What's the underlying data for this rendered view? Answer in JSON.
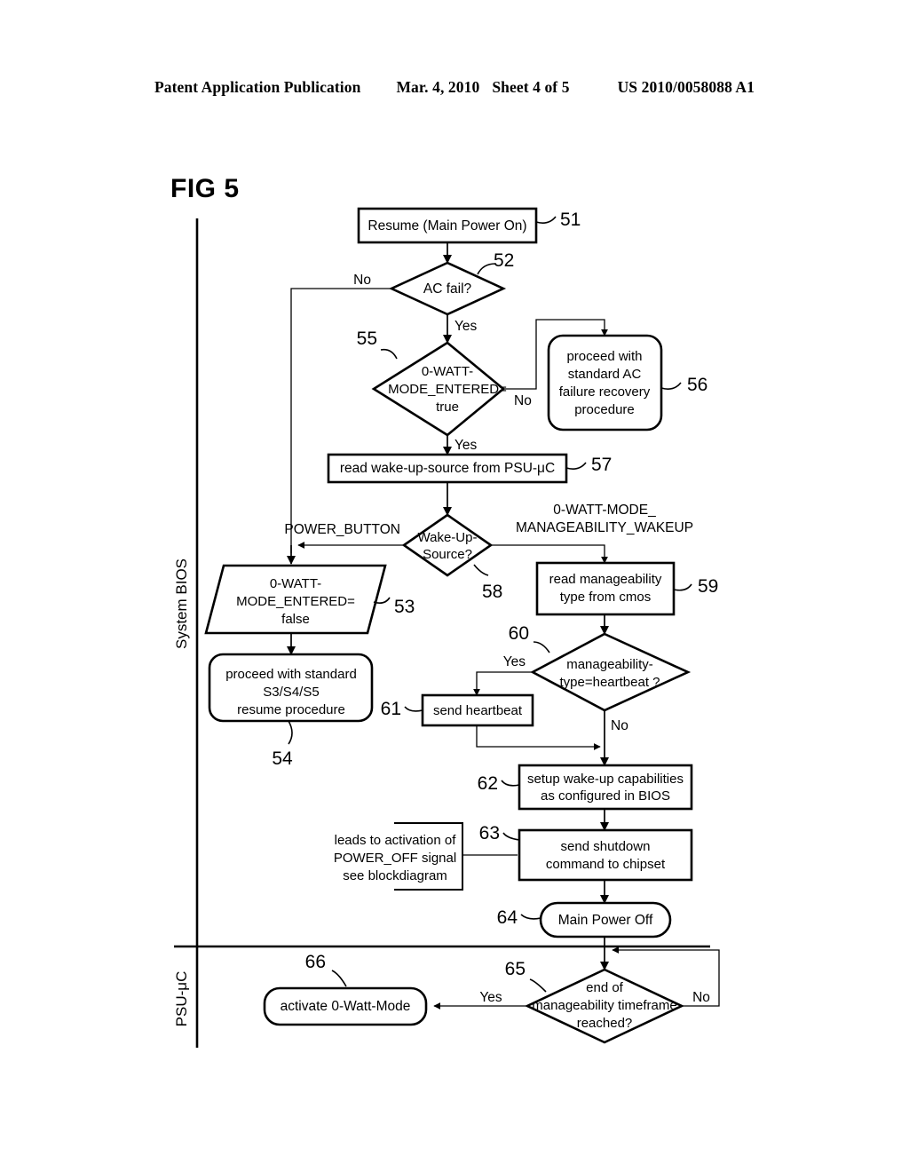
{
  "header": {
    "publication": "Patent Application Publication",
    "date": "Mar. 4, 2010",
    "sheet": "Sheet 4 of 5",
    "number": "US 2010/0058088 A1"
  },
  "figure": {
    "label": "FIG 5"
  },
  "lanes": [
    {
      "id": "system-bios",
      "label": "System BIOS"
    },
    {
      "id": "psu-uc",
      "label": "PSU-μC"
    }
  ],
  "nodes": {
    "n51": {
      "ref": "51",
      "text": "Resume (Main Power On)",
      "shape": "process"
    },
    "n52": {
      "ref": "52",
      "text": "AC fail?",
      "shape": "decision"
    },
    "n55": {
      "ref": "55",
      "line1": "0-WATT-",
      "line2": "MODE_ENTERED=",
      "line3": "true",
      "shape": "decision"
    },
    "n56": {
      "ref": "56",
      "line1": "proceed with",
      "line2": "standard AC",
      "line3": "failure recovery",
      "line4": "procedure",
      "shape": "rounded"
    },
    "n57": {
      "ref": "57",
      "text": "read wake-up-source from PSU-μC",
      "shape": "process"
    },
    "n58": {
      "ref": "58",
      "line1": "Wake-Up-",
      "line2": "Source?",
      "shape": "decision"
    },
    "n53": {
      "ref": "53",
      "line1": "0-WATT-",
      "line2": "MODE_ENTERED=",
      "line3": "false",
      "shape": "parallelogram"
    },
    "n54": {
      "ref": "54",
      "line1": "proceed with standard",
      "line2": "S3/S4/S5",
      "line3": "resume procedure",
      "shape": "rounded"
    },
    "n59": {
      "ref": "59",
      "line1": "read manageability",
      "line2": "type from cmos",
      "shape": "process"
    },
    "n60": {
      "ref": "60",
      "line1": "manageability-",
      "line2": "type=heartbeat ?",
      "shape": "decision"
    },
    "n61": {
      "ref": "61",
      "text": "send heartbeat",
      "shape": "process"
    },
    "n62": {
      "ref": "62",
      "line1": "setup wake-up capabilities",
      "line2": "as configured in BIOS",
      "shape": "process"
    },
    "n63": {
      "ref": "63",
      "line1": "send shutdown",
      "line2": "command to chipset",
      "shape": "process"
    },
    "n64": {
      "ref": "64",
      "text": "Main Power Off",
      "shape": "stadium"
    },
    "n65": {
      "ref": "65",
      "line1": "end of",
      "line2": "manageability timeframe",
      "line3": "reached?",
      "shape": "decision"
    },
    "n66": {
      "ref": "66",
      "text": "activate 0-Watt-Mode",
      "shape": "rounded"
    }
  },
  "annotation": {
    "line1": "leads to activation of",
    "line2": "POWER_OFF signal",
    "line3": "see blockdiagram"
  },
  "edge_labels": {
    "ac_fail_no": "No",
    "ac_fail_yes": "Yes",
    "mode_entered_no": "No",
    "mode_entered_yes": "Yes",
    "wakeup_power_button": "POWER_BUTTON",
    "wakeup_manageability_1": "0-WATT-MODE_",
    "wakeup_manageability_2": "MANAGEABILITY_WAKEUP",
    "heartbeat_yes": "Yes",
    "heartbeat_no": "No",
    "timeframe_yes": "Yes",
    "timeframe_no": "No"
  },
  "colors": {
    "ink": "#000000",
    "paper": "#ffffff"
  }
}
